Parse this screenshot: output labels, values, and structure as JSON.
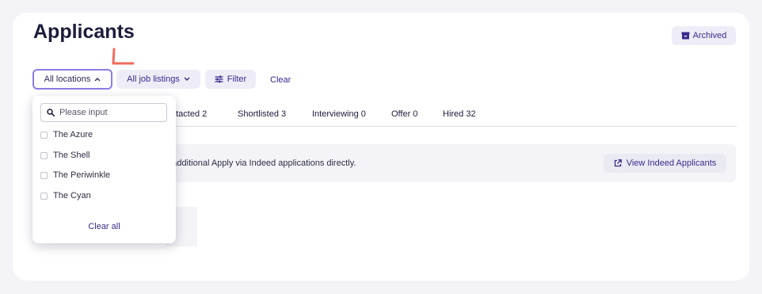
{
  "page": {
    "title": "Applicants"
  },
  "header": {
    "archived_label": "Archived"
  },
  "filters": {
    "locations_label": "All locations",
    "job_listings_label": "All job listings",
    "filter_label": "Filter",
    "clear_label": "Clear"
  },
  "tabs": [
    {
      "label": "ntacted 2"
    },
    {
      "label": "Shortlisted 3"
    },
    {
      "label": "Interviewing 0"
    },
    {
      "label": "Offer 0"
    },
    {
      "label": "Hired 32"
    }
  ],
  "banner": {
    "text": "ge additional Apply via Indeed applications directly.",
    "button_label": "View Indeed Applicants"
  },
  "dropdown": {
    "search_placeholder": "Please input",
    "options": [
      {
        "label": "The Azure"
      },
      {
        "label": "The Shell"
      },
      {
        "label": "The Periwinkle"
      },
      {
        "label": "The Cyan"
      }
    ],
    "clear_all_label": "Clear all"
  },
  "colors": {
    "accent": "#3a2a8c",
    "focus_border": "#8e7ce6",
    "annotation": "#f26b5b"
  }
}
